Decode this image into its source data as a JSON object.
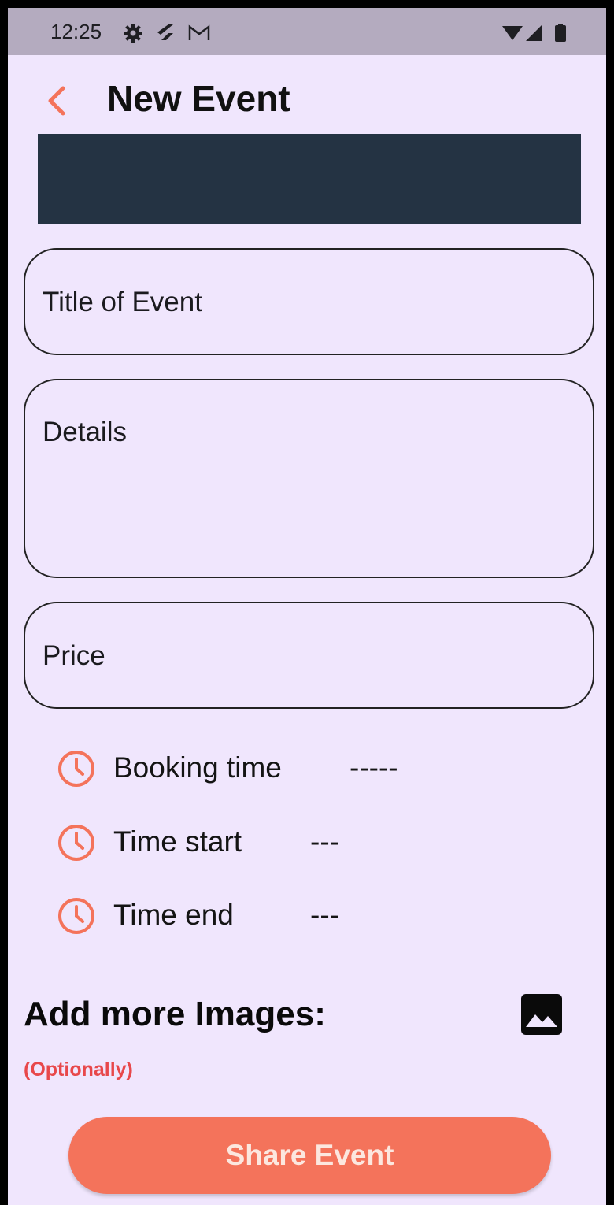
{
  "status_bar": {
    "time": "12:25",
    "icons_left": [
      "gear-icon",
      "flutter-icon",
      "gmail-icon"
    ],
    "icons_right": [
      "wifi-icon",
      "signal-icon",
      "battery-icon"
    ]
  },
  "header": {
    "back_icon": "chevron-left-icon",
    "title": "New Event"
  },
  "form": {
    "title_placeholder": "Title of Event",
    "details_placeholder": "Details",
    "price_placeholder": "Price"
  },
  "times": [
    {
      "icon": "clock-icon",
      "label": "Booking time",
      "value": "-----"
    },
    {
      "icon": "clock-icon",
      "label": "Time start",
      "value": "---"
    },
    {
      "icon": "clock-icon",
      "label": "Time end",
      "value": "---"
    }
  ],
  "images": {
    "heading": "Add more Images:",
    "note": "(Optionally)",
    "icon": "image-icon"
  },
  "share_button": "Share Event",
  "colors": {
    "accent": "#F4735B",
    "background": "#F0E6FD",
    "banner": "#243343",
    "status_bar": "#B4ABBF",
    "warning_text": "#E8484B"
  }
}
